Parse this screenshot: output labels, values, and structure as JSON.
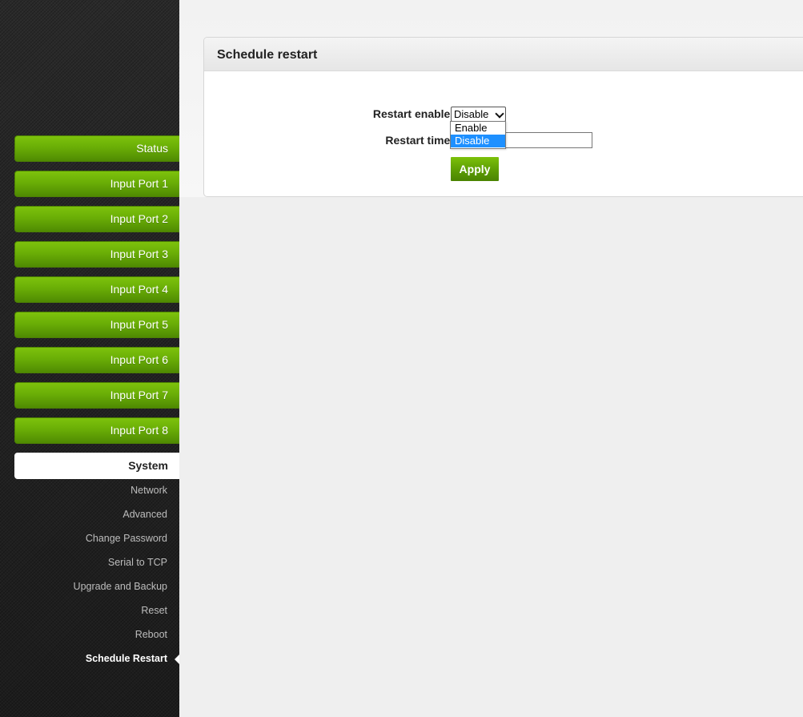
{
  "sidebar": {
    "nav_buttons": [
      {
        "label": "Status"
      },
      {
        "label": "Input Port 1"
      },
      {
        "label": "Input Port 2"
      },
      {
        "label": "Input Port 3"
      },
      {
        "label": "Input Port 4"
      },
      {
        "label": "Input Port 5"
      },
      {
        "label": "Input Port 6"
      },
      {
        "label": "Input Port 7"
      },
      {
        "label": "Input Port 8"
      }
    ],
    "section": {
      "label": "System"
    },
    "sub_items": [
      {
        "label": "Network"
      },
      {
        "label": "Advanced"
      },
      {
        "label": "Change Password"
      },
      {
        "label": "Serial to TCP"
      },
      {
        "label": "Upgrade and Backup"
      },
      {
        "label": "Reset"
      },
      {
        "label": "Reboot"
      },
      {
        "label": "Schedule Restart",
        "active": true
      }
    ]
  },
  "panel": {
    "title": "Schedule restart",
    "form": {
      "restart_enable_label": "Restart enable:",
      "restart_enable_value": "Disable",
      "restart_enable_options": [
        {
          "label": "Enable"
        },
        {
          "label": "Disable",
          "selected": true
        }
      ],
      "restart_time_label": "Restart time:",
      "restart_time_value": "",
      "apply_label": "Apply"
    }
  },
  "colors": {
    "accent_green": "#6aae06",
    "sidebar_dark": "#222222",
    "dropdown_highlight": "#1e90ff"
  }
}
